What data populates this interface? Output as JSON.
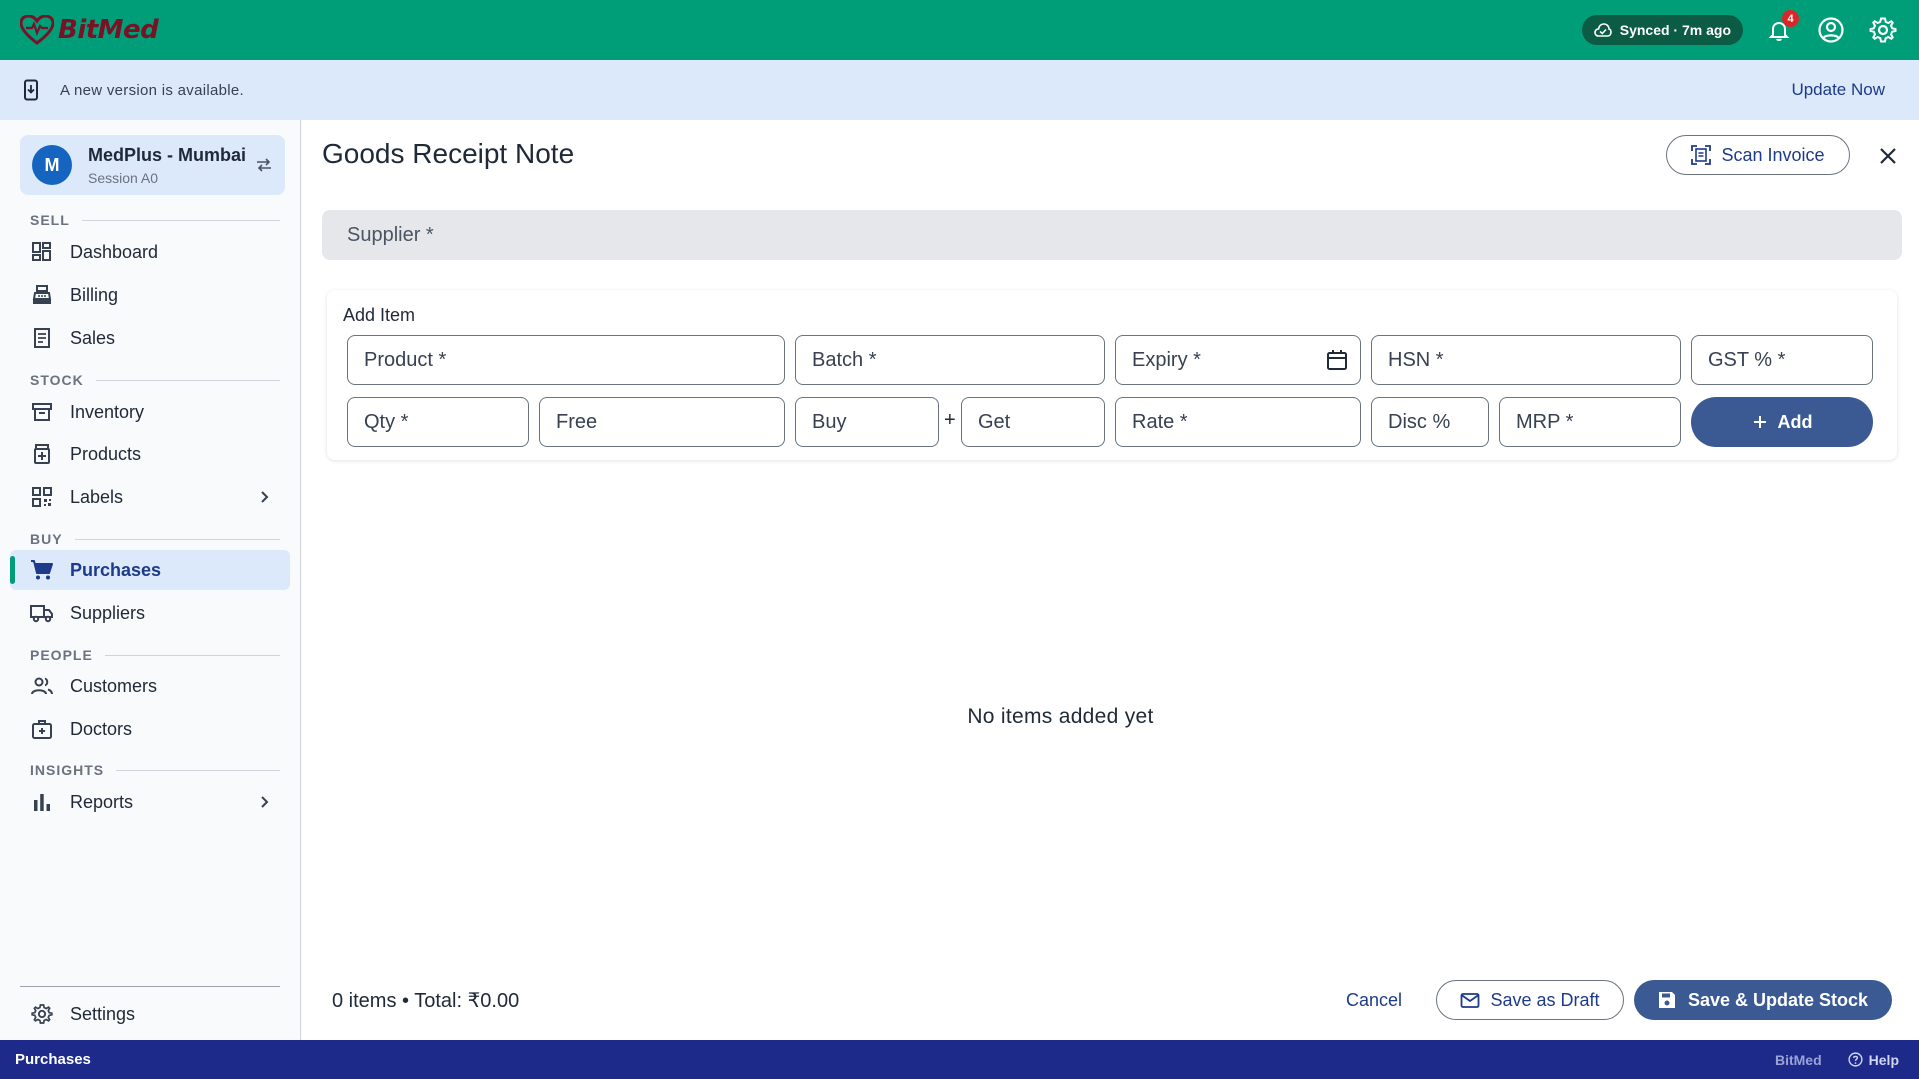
{
  "app": {
    "brand": "BitMed",
    "sync_status": "Synced · 7m ago",
    "notification_count": "4"
  },
  "banner": {
    "text": "A new version is available.",
    "action": "Update Now"
  },
  "store": {
    "avatar_letter": "M",
    "name": "MedPlus - Mumbai",
    "session": "Session A0"
  },
  "sidebar": {
    "sections": {
      "sell": "SELL",
      "stock": "STOCK",
      "buy": "BUY",
      "people": "PEOPLE",
      "insights": "INSIGHTS"
    },
    "items": {
      "dashboard": "Dashboard",
      "billing": "Billing",
      "sales": "Sales",
      "inventory": "Inventory",
      "products": "Products",
      "labels": "Labels",
      "purchases": "Purchases",
      "suppliers": "Suppliers",
      "customers": "Customers",
      "doctors": "Doctors",
      "reports": "Reports",
      "settings": "Settings"
    },
    "active_item": "purchases",
    "accent_color": "#009e78"
  },
  "grn": {
    "title": "Goods Receipt Note",
    "scan_label": "Scan Invoice",
    "supplier_placeholder": "Supplier *",
    "add_item_title": "Add Item",
    "fields": {
      "product": "Product *",
      "batch": "Batch *",
      "expiry": "Expiry *",
      "hsn": "HSN *",
      "gst": "GST % *",
      "qty": "Qty *",
      "free": "Free",
      "buy": "Buy",
      "plus": "+",
      "get": "Get",
      "rate": "Rate *",
      "disc": "Disc %",
      "mrp": "MRP *"
    },
    "add_label": "Add",
    "empty_text": "No items added yet",
    "totals": "0 items • Total: ₹0.00",
    "cancel_label": "Cancel",
    "draft_label": "Save as Draft",
    "save_label": "Save & Update Stock"
  },
  "statusbar": {
    "page": "Purchases",
    "brand": "BitMed",
    "help": "Help"
  },
  "icons": {
    "logo": "heart-logo-icon",
    "sync": "cloud-check-icon",
    "notifications": "bell-icon",
    "account": "account-circle-icon",
    "settings": "gear-icon",
    "download": "download-icon"
  },
  "colors": {
    "topbar": "#009e78",
    "primary_button": "#3b5a93",
    "statusbar": "#1e2a8a",
    "banner": "#dce9fb"
  }
}
